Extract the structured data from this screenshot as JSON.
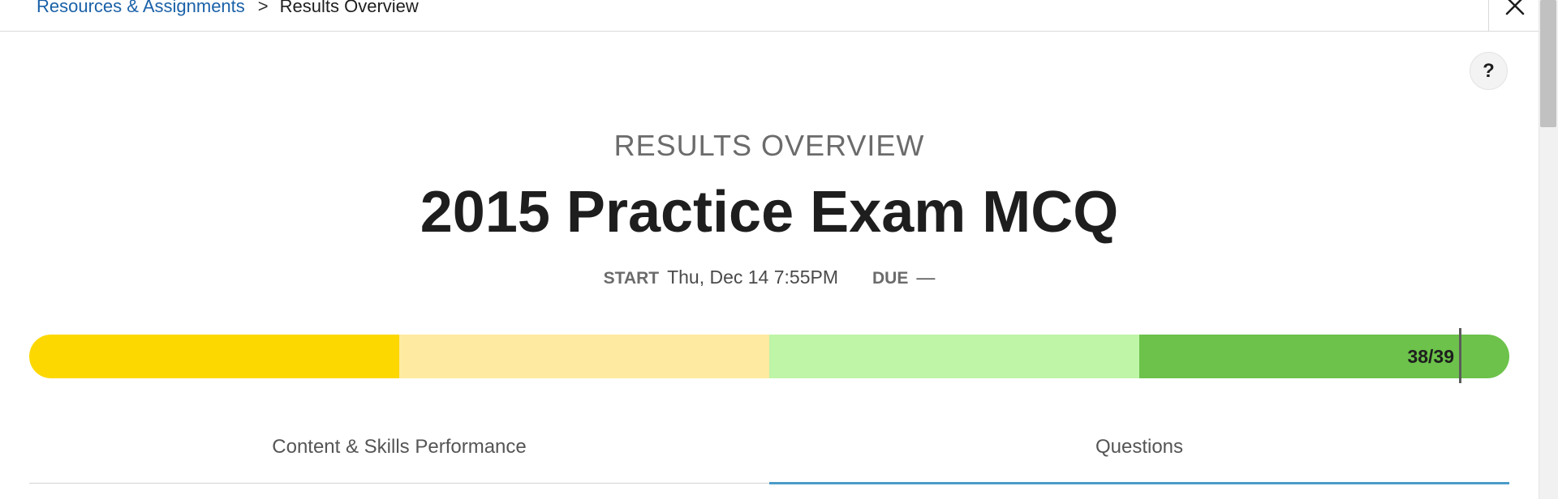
{
  "breadcrumb": {
    "link": "Resources & Assignments",
    "separator": ">",
    "current": "Results Overview"
  },
  "help": {
    "label": "?"
  },
  "header": {
    "overview_label": "RESULTS OVERVIEW",
    "title": "2015 Practice Exam MCQ"
  },
  "dates": {
    "start_key": "START",
    "start_value": "Thu, Dec 14 7:55PM",
    "due_key": "DUE",
    "due_value": "—"
  },
  "score": {
    "label": "38/39",
    "correct": 38,
    "total": 39,
    "band_colors": [
      "#fdd800",
      "#feeaa0",
      "#bef5a7",
      "#6cc24a"
    ]
  },
  "tabs": [
    {
      "label": "Content & Skills Performance",
      "active": false
    },
    {
      "label": "Questions",
      "active": true
    }
  ],
  "colors": {
    "link": "#1a61a8",
    "tab_underline": "#4a9cc8"
  }
}
